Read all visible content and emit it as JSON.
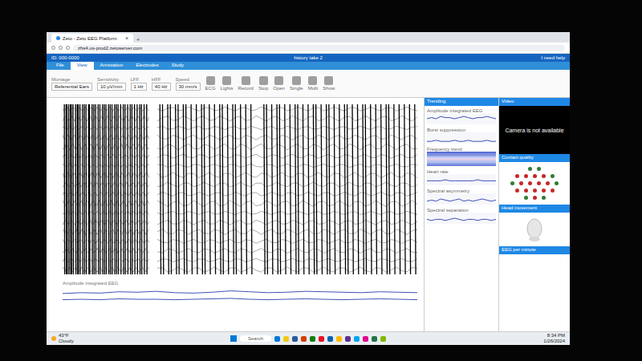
{
  "browser": {
    "tab_title": "Zeto - Zeto EEG Platform",
    "tab_close": "×",
    "new_tab": "+",
    "url": "zhs4.us-prod2.zetoserver.com"
  },
  "app": {
    "left_info": "ID: 000-0000",
    "title": "history take 2",
    "help": "I need help"
  },
  "menu": [
    {
      "label": "File",
      "selected": false
    },
    {
      "label": "View",
      "selected": true
    },
    {
      "label": "Annotation",
      "selected": false
    },
    {
      "label": "Electrodes",
      "selected": false
    },
    {
      "label": "Study",
      "selected": false
    }
  ],
  "toolbar": {
    "fields": [
      {
        "label": "Montage",
        "value": "Referential Ears"
      },
      {
        "label": "Sensitivity",
        "value": "10 µV/mm"
      },
      {
        "label": "LFF",
        "value": "1 Hz"
      },
      {
        "label": "HFF",
        "value": "40 Hz"
      },
      {
        "label": "Speed",
        "value": "30 mm/s"
      }
    ],
    "buttons": [
      {
        "label": "ECG"
      },
      {
        "label": "Lights"
      },
      {
        "label": "Record"
      },
      {
        "label": "Stop"
      },
      {
        "label": "Open"
      },
      {
        "label": "Single"
      },
      {
        "label": "Multi"
      },
      {
        "label": "Show"
      }
    ]
  },
  "eeg": {
    "channels": [
      0.6,
      0.8,
      0.5,
      0.7,
      0.9,
      0.6,
      0.5,
      0.8,
      0.7,
      0.6,
      0.9,
      0.5,
      0.7,
      0.8,
      0.6,
      0.7,
      0.5,
      0.8
    ],
    "segments": [
      {
        "spikes": [
          2,
          4,
          5,
          7,
          9,
          10,
          12,
          15,
          17,
          18,
          20,
          23,
          25,
          27,
          30,
          31,
          34,
          36,
          38,
          41,
          43,
          46,
          48,
          50,
          53,
          55,
          57,
          60,
          62,
          64,
          67,
          70,
          72,
          75,
          78,
          80,
          83,
          86,
          89,
          91,
          94,
          97
        ]
      },
      {
        "spikes": [
          1,
          2,
          4,
          5,
          7,
          8,
          10,
          11,
          13,
          15,
          17,
          18,
          20,
          22,
          24,
          25,
          27,
          29,
          30,
          32,
          34,
          36,
          41,
          42,
          44,
          46,
          47,
          49,
          51,
          53,
          54,
          56,
          58,
          60,
          61,
          63,
          65,
          66,
          68,
          70,
          72,
          73,
          75,
          77,
          79,
          80,
          82,
          84,
          86,
          88,
          89,
          91,
          93,
          95,
          97,
          99
        ]
      }
    ],
    "aeeg_label": "Amplitude integrated EEG",
    "aeeg_upper": [
      22,
      24,
      23,
      26,
      25,
      27,
      24,
      23,
      25,
      28,
      26,
      24,
      25,
      27,
      26,
      25,
      24,
      26,
      25,
      24
    ],
    "aeeg_lower": [
      8,
      9,
      8,
      10,
      9,
      9,
      8,
      9,
      10,
      11,
      9,
      8,
      9,
      10,
      9,
      8,
      9,
      10,
      9,
      8
    ]
  },
  "trending": {
    "title": "Trending",
    "sections": [
      {
        "title": "Amplitude integrated EEG",
        "kind": "trace",
        "values": [
          5,
          6,
          5,
          7,
          6,
          6,
          5,
          6,
          7,
          6,
          5,
          6,
          6,
          7,
          6,
          5
        ]
      },
      {
        "title": "Burst suppression",
        "kind": "trace",
        "values": [
          2,
          2,
          3,
          2,
          2,
          2,
          3,
          2,
          2,
          3,
          2,
          2,
          2,
          3,
          2,
          2
        ]
      },
      {
        "title": "Frequency trend",
        "kind": "heatmap",
        "colors": [
          "#5b6fd6",
          "#7c8fe0",
          "#a6b4ec",
          "#d3d9f5",
          "#e9c9e6",
          "#b4c2ef",
          "#8fa1e6",
          "#6d80dc"
        ]
      },
      {
        "title": "Heart rate",
        "kind": "trace",
        "values": [
          4,
          4,
          4,
          4,
          5,
          4,
          4,
          4,
          4,
          4,
          4,
          5,
          4,
          4,
          4,
          4
        ]
      },
      {
        "title": "Spectral asymmetry",
        "kind": "trace",
        "values": [
          3,
          4,
          3,
          5,
          4,
          3,
          4,
          5,
          3,
          4,
          3,
          4,
          5,
          4,
          3,
          4
        ]
      },
      {
        "title": "Spectral separation",
        "kind": "trace",
        "values": [
          4,
          3,
          4,
          4,
          3,
          4,
          5,
          4,
          3,
          4,
          4,
          3,
          4,
          4,
          3,
          4
        ]
      }
    ]
  },
  "video": {
    "title": "Video",
    "message": "Camera is not available"
  },
  "contact_quality": {
    "title": "Contact quality",
    "rows": [
      [
        "#2e7d32",
        "#2e7d32"
      ],
      [
        "#c62828",
        "#c62828",
        "#c62828",
        "#c62828",
        "#2e7d32"
      ],
      [
        "#2e7d32",
        "#c62828",
        "#c62828",
        "#c62828",
        "#c62828",
        "#2e7d32"
      ],
      [
        "#c62828",
        "#c62828",
        "#c62828",
        "#c62828",
        "#c62828"
      ],
      [
        "#2e7d32",
        "#c62828",
        "#2e7d32"
      ]
    ]
  },
  "head_movement": {
    "title": "Head movement"
  },
  "eeg_per_minute": {
    "title": "EEG per minute"
  },
  "taskbar": {
    "weather_temp": "43°F",
    "weather_text": "Cloudy",
    "search": "Search",
    "apps": [
      "#0078d4",
      "#f2c811",
      "#2b579a",
      "#d83b01",
      "#107c10",
      "#e81123",
      "#0063b1",
      "#ffb900",
      "#5c2d91",
      "#00a4ef",
      "#e3008c",
      "#217346",
      "#7fba00"
    ],
    "time": "8:34 PM",
    "date": "1/26/2024"
  }
}
